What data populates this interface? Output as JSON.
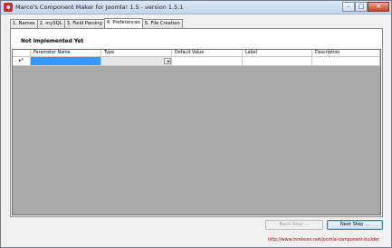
{
  "window": {
    "title": "Marco's Component Maker for Joomla! 1.5 - version 1.5.1",
    "controls": {
      "minimize": "–",
      "maximize": "□",
      "close": "✕"
    }
  },
  "tabs": [
    {
      "label": "1. Names"
    },
    {
      "label": "2. mySQL"
    },
    {
      "label": "3. Field Parsing"
    },
    {
      "label": "4. Preferences",
      "active": true
    },
    {
      "label": "5. File Creation"
    }
  ],
  "page": {
    "notice": "Not Implemented  Yet"
  },
  "grid": {
    "columns": [
      "Parameter Name",
      "Type",
      "Default Value",
      "Label",
      "Description"
    ],
    "new_row_marker": "▸*",
    "rows": [
      {
        "parameter_name": "",
        "type": "",
        "default_value": "",
        "label": "",
        "description": ""
      }
    ]
  },
  "buttons": {
    "back": "Back Step ...",
    "next": "Next Step ..."
  },
  "footer": {
    "link": "http://www.mmleoni.net/joomla-component-builder"
  },
  "colors": {
    "selection": "#3399ff",
    "grid_background": "#a9a9a9",
    "link": "#c00000"
  }
}
